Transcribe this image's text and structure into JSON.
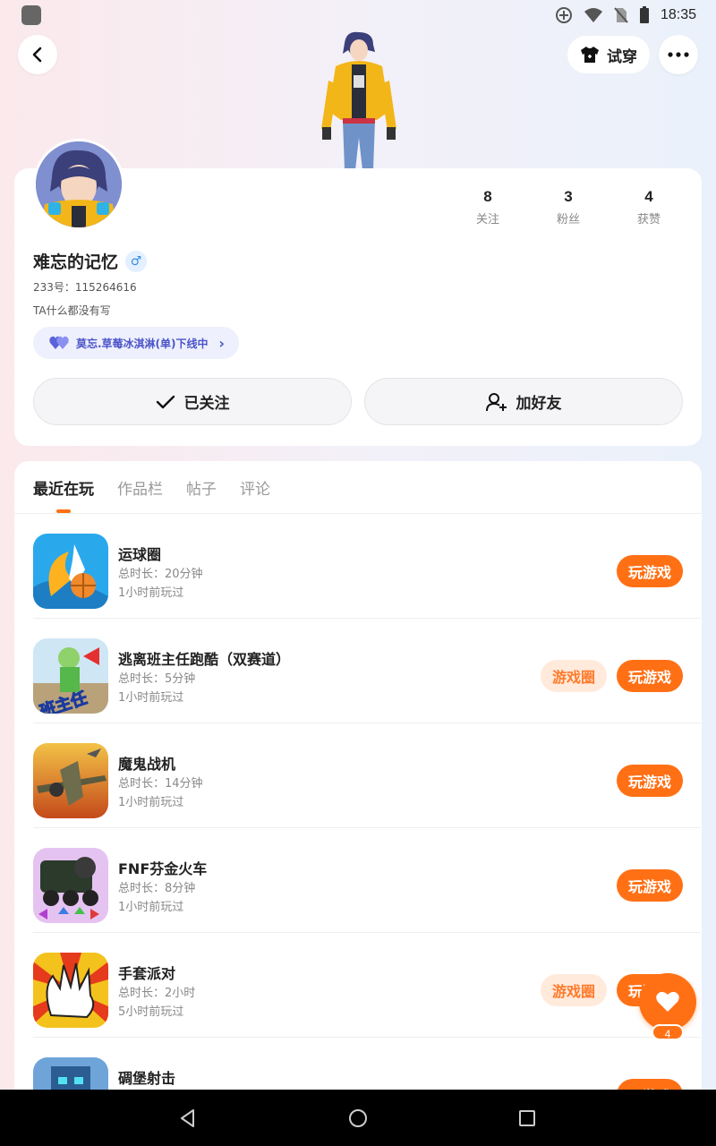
{
  "status_bar": {
    "time": "18:35"
  },
  "header": {
    "try_on_label": "试穿"
  },
  "profile": {
    "username": "难忘的记忆",
    "gender": "♂",
    "user_id": "233号：115264616",
    "bio": "TA什么都没有写",
    "online_status": "莫忘.草莓冰淇淋(单)下线中",
    "stats": [
      {
        "value": "8",
        "label": "关注"
      },
      {
        "value": "3",
        "label": "粉丝"
      },
      {
        "value": "4",
        "label": "获赞"
      }
    ],
    "follow_label": "已关注",
    "add_friend_label": "加好友"
  },
  "tabs": [
    {
      "label": "最近在玩",
      "active": true
    },
    {
      "label": "作品栏",
      "active": false
    },
    {
      "label": "帖子",
      "active": false
    },
    {
      "label": "评论",
      "active": false
    }
  ],
  "games": [
    {
      "title": "运球圈",
      "duration": "总时长：20分钟",
      "last_played": "1小时前玩过",
      "play_label": "玩游戏",
      "has_circle": false
    },
    {
      "title": "逃离班主任跑酷（双赛道）",
      "duration": "总时长：5分钟",
      "last_played": "1小时前玩过",
      "play_label": "玩游戏",
      "circle_label": "游戏圈",
      "has_circle": true
    },
    {
      "title": "魔鬼战机",
      "duration": "总时长：14分钟",
      "last_played": "1小时前玩过",
      "play_label": "玩游戏",
      "has_circle": false
    },
    {
      "title": "FNF芬金火车",
      "duration": "总时长：8分钟",
      "last_played": "1小时前玩过",
      "play_label": "玩游戏",
      "has_circle": false
    },
    {
      "title": "手套派对",
      "duration": "总时长：2小时",
      "last_played": "5小时前玩过",
      "play_label": "玩游戏",
      "circle_label": "游戏圈",
      "has_circle": true
    },
    {
      "title": "碉堡射击",
      "duration": "",
      "last_played": "",
      "play_label": "玩游戏",
      "has_circle": false
    }
  ],
  "fab": {
    "count": "4"
  },
  "icon_text": {
    "game2": "班主任"
  },
  "colors": {
    "accent": "#ff7015",
    "accent_light": "#ffeadb",
    "purple": "#4b54c8"
  }
}
